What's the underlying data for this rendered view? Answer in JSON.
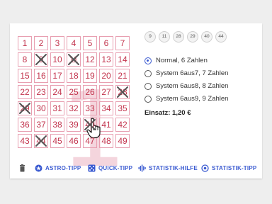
{
  "numbers": [
    1,
    2,
    3,
    4,
    5,
    6,
    7,
    8,
    9,
    10,
    11,
    12,
    13,
    14,
    15,
    16,
    17,
    18,
    19,
    20,
    21,
    22,
    23,
    24,
    25,
    26,
    27,
    28,
    29,
    30,
    31,
    32,
    33,
    34,
    35,
    36,
    37,
    38,
    39,
    40,
    41,
    42,
    43,
    44,
    45,
    46,
    47,
    48,
    49
  ],
  "crossed": [
    9,
    11,
    28,
    29,
    40,
    44
  ],
  "watermark_digit": "1",
  "selected_chips": [
    "9",
    "11",
    "28",
    "29",
    "40",
    "44"
  ],
  "options": [
    {
      "label": "Normal, 6 Zahlen",
      "checked": true
    },
    {
      "label": "System 6aus7, 7 Zahlen",
      "checked": false
    },
    {
      "label": "System 6aus8, 8 Zahlen",
      "checked": false
    },
    {
      "label": "System 6aus9, 9 Zahlen",
      "checked": false
    }
  ],
  "einsatz": "Einsatz: 1,20 €",
  "toolbar": {
    "delete_icon": "trash-icon",
    "astro": {
      "label": "ASTRO-TIPP",
      "icon": "star-circle-icon"
    },
    "quick": {
      "label": "QUICK-TIPP",
      "icon": "dice-icon"
    },
    "stats_help": {
      "label": "STATISTIK-HILFE",
      "icon": "waveform-icon"
    },
    "stats": {
      "label": "STATISTIK-TIPP",
      "icon": "target-icon"
    }
  },
  "colors": {
    "accent": "#3b5bd1",
    "cell_border": "#e89fb1",
    "cell_text": "#c2344d",
    "cross": "#555555"
  }
}
